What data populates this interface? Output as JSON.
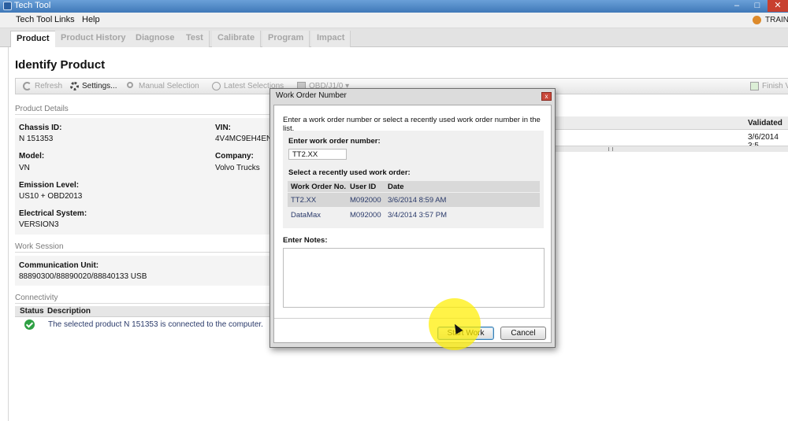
{
  "window": {
    "title": "Tech Tool",
    "controls": {
      "minimize": "–",
      "maximize": "□",
      "close": "✕"
    }
  },
  "menu": {
    "items": [
      "Tech Tool",
      "Links",
      "Help"
    ],
    "mode": "TRAIN"
  },
  "tabs": [
    "Product",
    "Product History",
    "Diagnose",
    "Test",
    "Calibrate",
    "Program",
    "Impact"
  ],
  "page": {
    "title": "Identify Product"
  },
  "toolbar": {
    "refresh": "Refresh",
    "settings": "Settings...",
    "manual_selection": "Manual Selection",
    "latest_selections": "Latest Selections",
    "obd": "OBD/J1/0 ▾",
    "finish": "Finish V"
  },
  "product_details": {
    "section": "Product Details",
    "chassis_label": "Chassis ID:",
    "chassis_value": "N 151353",
    "vin_label": "VIN:",
    "vin_value": "4V4MC9EH4EN",
    "model_label": "Model:",
    "model_value": "VN",
    "company_label": "Company:",
    "company_value": "Volvo Trucks",
    "emission_label": "Emission Level:",
    "emission_value": "US10 + OBD2013",
    "electrical_label": "Electrical System:",
    "electrical_value": "VERSION3"
  },
  "right_table": {
    "validated_header": "Validated",
    "validated_value": "3/6/2014 3:5"
  },
  "work_session": {
    "section": "Work Session",
    "comm_label": "Communication Unit:",
    "comm_value": "88890300/88890020/88840133 USB"
  },
  "connectivity": {
    "section": "Connectivity",
    "status_header": "Status",
    "description_header": "Description",
    "row_text": "The selected product N 151353 is connected to the computer."
  },
  "dialog": {
    "title": "Work Order Number",
    "close": "x",
    "instruction": "Enter a work order number or select a recently used work order number in the list.",
    "enter_label": "Enter work order number:",
    "input_value": "TT2.XX",
    "recent_label": "Select a recently used work order:",
    "columns": [
      "Work Order No.",
      "User ID",
      "Date"
    ],
    "rows": [
      {
        "wo": "TT2.XX",
        "user": "M092000",
        "date": "3/6/2014 8:59 AM"
      },
      {
        "wo": "DataMax",
        "user": "M092000",
        "date": "3/4/2014 3:57 PM"
      }
    ],
    "selected_row": 0,
    "notes_label": "Enter Notes:",
    "start_button": "Start Work",
    "cancel_button": "Cancel"
  },
  "colors": {
    "titlebar": "#3f78b8",
    "status_ok": "#2ea043",
    "highlight": "#ffee00",
    "accent_button": "#3c7fb1"
  }
}
